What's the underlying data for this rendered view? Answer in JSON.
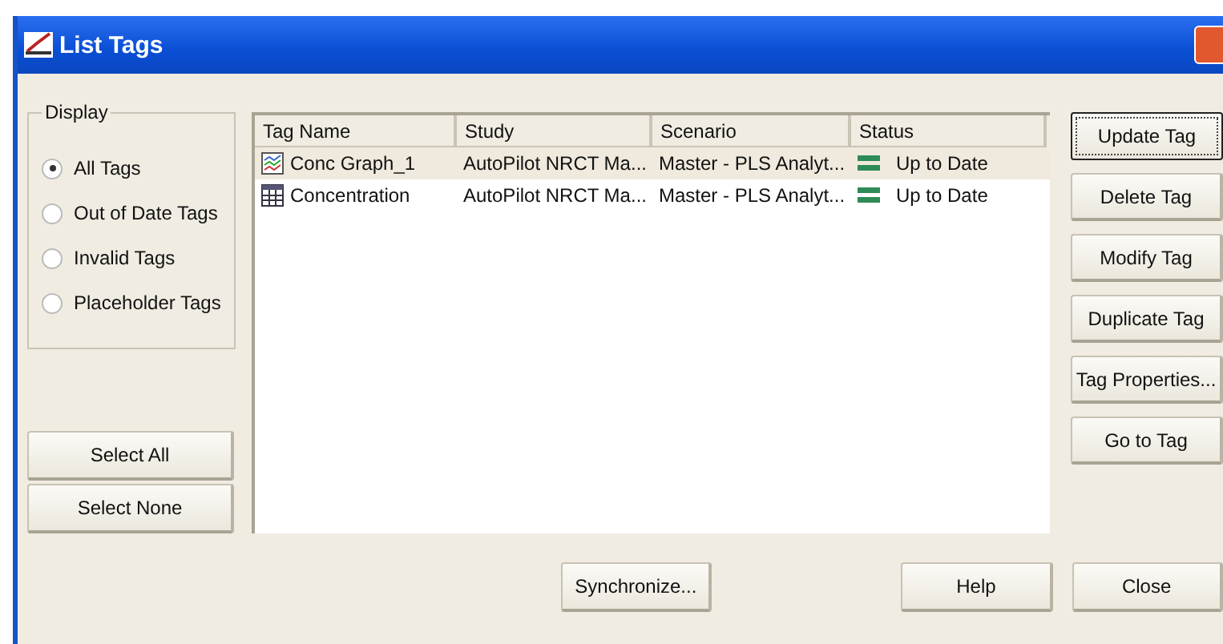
{
  "window": {
    "title": "List Tags"
  },
  "display": {
    "label": "Display",
    "options": [
      {
        "label": "All Tags",
        "selected": true
      },
      {
        "label": "Out of Date Tags",
        "selected": false
      },
      {
        "label": "Invalid Tags",
        "selected": false
      },
      {
        "label": "Placeholder Tags",
        "selected": false
      }
    ]
  },
  "select_buttons": [
    "Select All",
    "Select None"
  ],
  "table": {
    "columns": [
      "Tag Name",
      "Study",
      "Scenario",
      "Status"
    ],
    "rows": [
      {
        "kind": "graph",
        "tag_name": "Conc Graph_1",
        "study": "AutoPilot NRCT Ma...",
        "scenario": "Master - PLS Analyt...",
        "status": "Up to Date",
        "selected": true
      },
      {
        "kind": "table",
        "tag_name": "Concentration",
        "study": "AutoPilot NRCT Ma...",
        "scenario": "Master - PLS Analyt...",
        "status": "Up to Date",
        "selected": false
      }
    ]
  },
  "side_buttons": [
    {
      "label": "Update Tag",
      "focused": true
    },
    {
      "label": "Delete Tag",
      "focused": false
    },
    {
      "label": "Modify Tag",
      "focused": false
    },
    {
      "label": "Duplicate Tag",
      "focused": false
    },
    {
      "label": "Tag Properties...",
      "focused": false
    },
    {
      "label": "Go to Tag",
      "focused": false
    }
  ],
  "bottom_buttons": [
    "Synchronize...",
    "Help",
    "Close"
  ]
}
